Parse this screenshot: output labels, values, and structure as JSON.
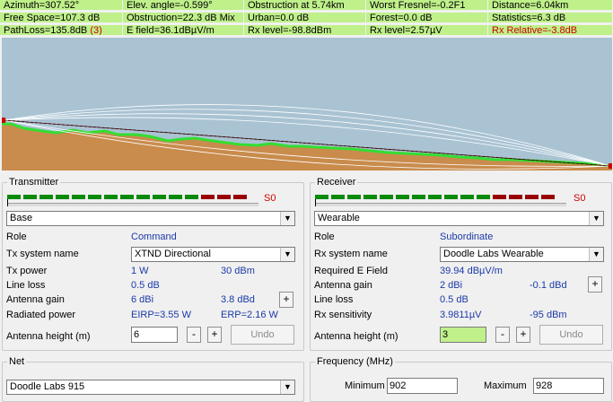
{
  "stats": {
    "row1": [
      "Azimuth=307.52°",
      "Elev. angle=-0.599°",
      "Obstruction at 5.74km",
      "Worst Fresnel=-0.2F1",
      "Distance=6.04km"
    ],
    "row2": [
      "Free Space=107.3 dB",
      "Obstruction=22.3 dB Mix",
      "Urban=0.0 dB",
      "Forest=0.0 dB",
      "Statistics=6.3 dB"
    ],
    "row3": [
      "PathLoss=135.8dB",
      "E field=36.1dBµV/m",
      "Rx level=-98.8dBm",
      "Rx level=2.57µV",
      "Rx Relative=-3.8dB"
    ],
    "pathloss_suffix": "(3)"
  },
  "colors": {
    "stat_cell": "#bff08a",
    "sky": "#a9c3d3",
    "terrain": "#c98c4d",
    "vegetation": "#33dd33",
    "fresnel": "#ffffff",
    "los": "#cc0000",
    "alert": "#d00000",
    "link_blue": "#1a3aa8"
  },
  "profile": {
    "terrain_fill": "terrain",
    "vegetation_line": "vegetation",
    "fresnel_lines": "fresnel",
    "line_of_sight": "los"
  },
  "transmitter": {
    "title": "Transmitter",
    "meter_value": "S0",
    "meter_segments": [
      "green",
      "green",
      "green",
      "green",
      "green",
      "green",
      "green",
      "green",
      "green",
      "green",
      "green",
      "green",
      "red",
      "red",
      "red"
    ],
    "unit": "Base",
    "role_label": "Role",
    "role_value": "Command",
    "system_label": "Tx system name",
    "system_value": "XTND Directional",
    "power_label": "Tx power",
    "power_w": "1 W",
    "power_dbm": "30 dBm",
    "lineloss_label": "Line loss",
    "lineloss_value": "0.5 dB",
    "gain_label": "Antenna gain",
    "gain_dbi": "6 dBi",
    "gain_dbd": "3.8 dBd",
    "radiated_label": "Radiated power",
    "eirp": "EIRP=3.55 W",
    "erp": "ERP=2.16 W",
    "height_label": "Antenna height (m)",
    "height_value": "6",
    "minus": "-",
    "plus": "+",
    "undo": "Undo"
  },
  "receiver": {
    "title": "Receiver",
    "meter_value": "S0",
    "meter_segments": [
      "green",
      "green",
      "green",
      "green",
      "green",
      "green",
      "green",
      "green",
      "green",
      "green",
      "green",
      "red",
      "red",
      "red",
      "red"
    ],
    "unit": "Wearable",
    "role_label": "Role",
    "role_value": "Subordinate",
    "system_label": "Rx system name",
    "system_value": "Doodle Labs Wearable",
    "field_label": "Required E Field",
    "field_value": "39.94 dBµV/m",
    "gain_label": "Antenna gain",
    "gain_dbi": "2 dBi",
    "gain_dbd": "-0.1 dBd",
    "lineloss_label": "Line loss",
    "lineloss_value": "0.5 dB",
    "sens_label": "Rx sensitivity",
    "sens_uv": "3.9811µV",
    "sens_dbm": "-95 dBm",
    "height_label": "Antenna height (m)",
    "height_value": "3",
    "minus": "-",
    "plus": "+",
    "undo": "Undo"
  },
  "net": {
    "title": "Net",
    "value": "Doodle Labs 915"
  },
  "frequency": {
    "title": "Frequency (MHz)",
    "min_label": "Minimum",
    "min_value": "902",
    "max_label": "Maximum",
    "max_value": "928"
  }
}
